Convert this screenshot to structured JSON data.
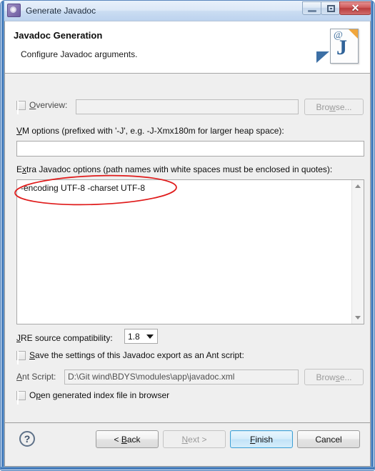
{
  "window": {
    "title": "Generate Javadoc",
    "app_icon": "gear-icon",
    "controls": {
      "minimize": "minimize-icon",
      "maximize": "maximize-icon",
      "close": "✕"
    }
  },
  "banner": {
    "title": "Javadoc Generation",
    "subtitle": "Configure Javadoc arguments.",
    "icon": "javadoc-page-icon",
    "icon_at": "@",
    "icon_letter": "J"
  },
  "form": {
    "overview": {
      "checkbox_label": "Overview:",
      "underline_char": "O",
      "value": "",
      "browse_label": "Browse...",
      "browse_underline": "s",
      "enabled": false
    },
    "vm_options": {
      "label": "VM options (prefixed with '-J', e.g. -J-Xmx180m for larger heap space):",
      "underline_char": "V",
      "value": ""
    },
    "extra_options": {
      "label": "Extra Javadoc options (path names with white spaces must be enclosed in quotes):",
      "underline_char": "x",
      "value": "-encoding UTF-8 -charset UTF-8"
    },
    "jre": {
      "label": "JRE source compatibility:",
      "underline_char": "J",
      "selected": "1.8"
    },
    "save_ant": {
      "label": "Save the settings of this Javadoc export as an Ant script:",
      "underline_char": "S",
      "checked": false
    },
    "ant_script": {
      "label": "Ant Script:",
      "underline_char": "A",
      "value": "D:\\Git wind\\BDYS\\modules\\app\\javadoc.xml",
      "browse_label": "Browse...",
      "browse_underline": "s",
      "enabled": false
    },
    "open_index": {
      "label": "Open generated index file in browser",
      "underline_char": "p",
      "checked": false
    }
  },
  "footer": {
    "help": "?",
    "back": "< Back",
    "next": "Next >",
    "finish": "Finish",
    "cancel": "Cancel"
  },
  "annotation": {
    "shape": "ellipse",
    "color": "#e01b1b",
    "target": "-encoding UTF-8 -charset UTF-8"
  }
}
